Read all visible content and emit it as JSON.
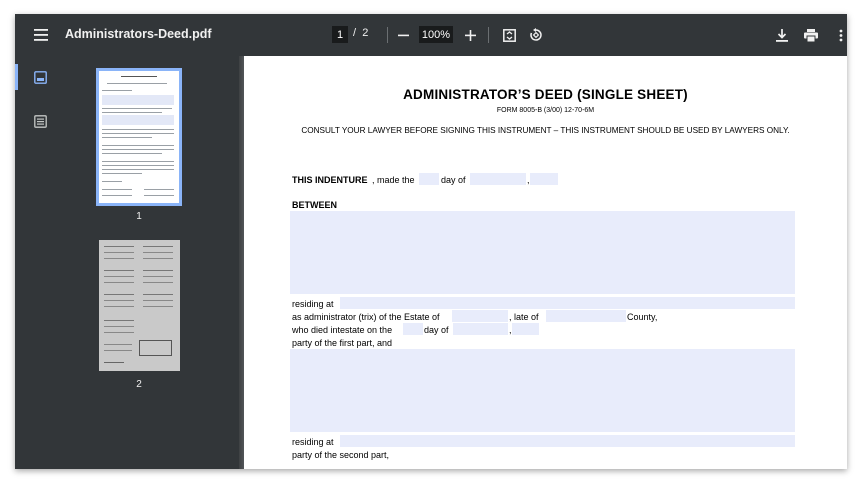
{
  "toolbar": {
    "menu_icon": "hamburger-menu-icon",
    "title": "Administrators-Deed.pdf",
    "current_page": "1",
    "page_separator": "/",
    "total_pages": "2",
    "zoom_level": "100%",
    "zoom_out_icon": "minus-icon",
    "zoom_in_icon": "plus-icon",
    "fit_icon": "fit-to-page-icon",
    "rotate_icon": "rotate-icon",
    "download_icon": "download-icon",
    "print_icon": "print-icon",
    "more_icon": "more-vert-icon"
  },
  "sidebar": {
    "thumbnails_icon": "thumbnails-icon",
    "outline_icon": "outline-icon",
    "thumbnails": [
      {
        "label": "1"
      },
      {
        "label": "2"
      }
    ]
  },
  "document": {
    "title": "ADMINISTRATOR’S DEED (SINGLE SHEET)",
    "form_number": "FORM 8005-B (3/00) 12-70-6M",
    "consult_notice": "CONSULT YOUR LAWYER BEFORE SIGNING THIS INSTRUMENT – THIS INSTRUMENT SHOULD BE USED BY LAWYERS ONLY.",
    "indenture_label": "THIS INDENTURE",
    "indenture_text": ", made the",
    "day_of": "day of",
    "comma": ",",
    "between": "BETWEEN",
    "residing_at": "residing at",
    "as_administrator": "as administrator (trix) of the Estate of",
    "late_of": ", late of",
    "county": "County,",
    "who_died": "who died intestate on the",
    "day_of_2": "day of",
    "comma_2": ",",
    "first_part": "party of the first part, and",
    "residing_at_2": "residing at",
    "second_part": "party of the second part,"
  }
}
